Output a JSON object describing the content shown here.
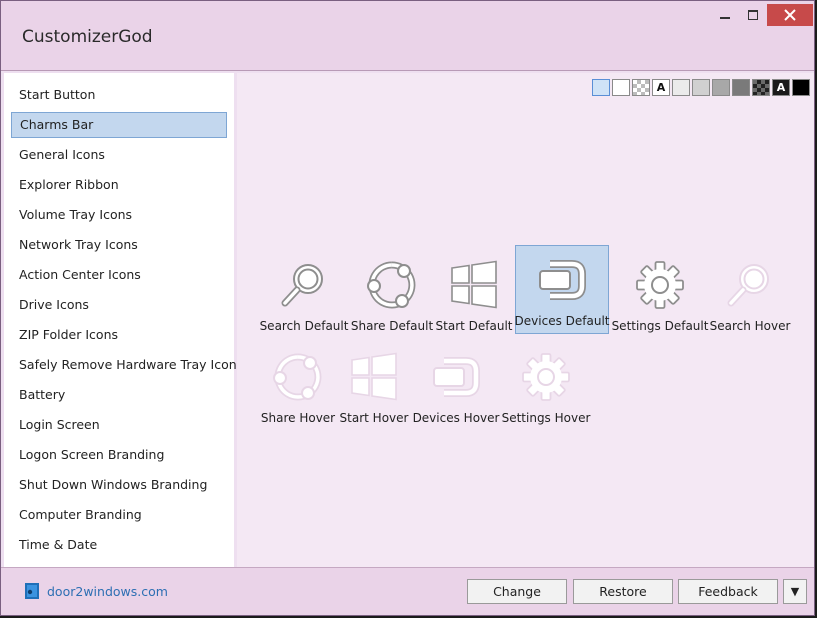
{
  "app": {
    "title": "CustomizerGod"
  },
  "window_buttons": {
    "minimize": "minimize-icon",
    "maximize": "maximize-icon",
    "close": "close-icon"
  },
  "sidebar": {
    "items": [
      {
        "label": "Start Button"
      },
      {
        "label": "Charms Bar",
        "selected": true
      },
      {
        "label": "General Icons"
      },
      {
        "label": "Explorer Ribbon"
      },
      {
        "label": "Volume Tray Icons"
      },
      {
        "label": "Network Tray Icons"
      },
      {
        "label": "Action Center Icons"
      },
      {
        "label": "Drive Icons"
      },
      {
        "label": "ZIP Folder Icons"
      },
      {
        "label": "Safely Remove Hardware Tray Icon"
      },
      {
        "label": "Battery"
      },
      {
        "label": "Login Screen"
      },
      {
        "label": "Logon Screen Branding"
      },
      {
        "label": "Shut Down Windows Branding"
      },
      {
        "label": "Computer Branding"
      },
      {
        "label": "Time & Date"
      }
    ]
  },
  "swatches": [
    {
      "color": "#cfe3f7",
      "selected": true
    },
    {
      "color": "#ffffff"
    },
    {
      "pattern": "checker-light"
    },
    {
      "color": "#ffffff",
      "text": "A"
    },
    {
      "color": "#ebebeb"
    },
    {
      "color": "#d0d0d0"
    },
    {
      "color": "#a8a8a8"
    },
    {
      "color": "#7a7a7a"
    },
    {
      "pattern": "checker-dark"
    },
    {
      "color": "#1a1a1a",
      "text": "A",
      "text_color": "#ffffff"
    },
    {
      "color": "#000000"
    }
  ],
  "icons": [
    {
      "label": "Search Default",
      "icon": "search-icon",
      "style": "default"
    },
    {
      "label": "Share Default",
      "icon": "share-icon",
      "style": "default"
    },
    {
      "label": "Start Default",
      "icon": "windows-start-icon",
      "style": "default"
    },
    {
      "label": "Devices Default",
      "icon": "devices-icon",
      "style": "default",
      "selected": true
    },
    {
      "label": "Settings Default",
      "icon": "gear-icon",
      "style": "default"
    },
    {
      "label": "Search Hover",
      "icon": "search-icon",
      "style": "hover"
    },
    {
      "label": "Share Hover",
      "icon": "share-icon",
      "style": "hover"
    },
    {
      "label": "Start Hover",
      "icon": "windows-start-icon",
      "style": "hover"
    },
    {
      "label": "Devices Hover",
      "icon": "devices-icon",
      "style": "hover"
    },
    {
      "label": "Settings Hover",
      "icon": "gear-icon",
      "style": "hover"
    }
  ],
  "footer": {
    "logo_text": "door2windows.com",
    "buttons": {
      "change": "Change",
      "restore": "Restore",
      "feedback": "Feedback",
      "dropdown": "▼"
    }
  },
  "colors": {
    "selection": "#c3d7ee",
    "selection_border": "#7ea6d4",
    "title_bg": "#ead3e8",
    "content_bg": "#f4e8f4",
    "close_bg": "#c74a4a",
    "link": "#2d6fb3"
  }
}
